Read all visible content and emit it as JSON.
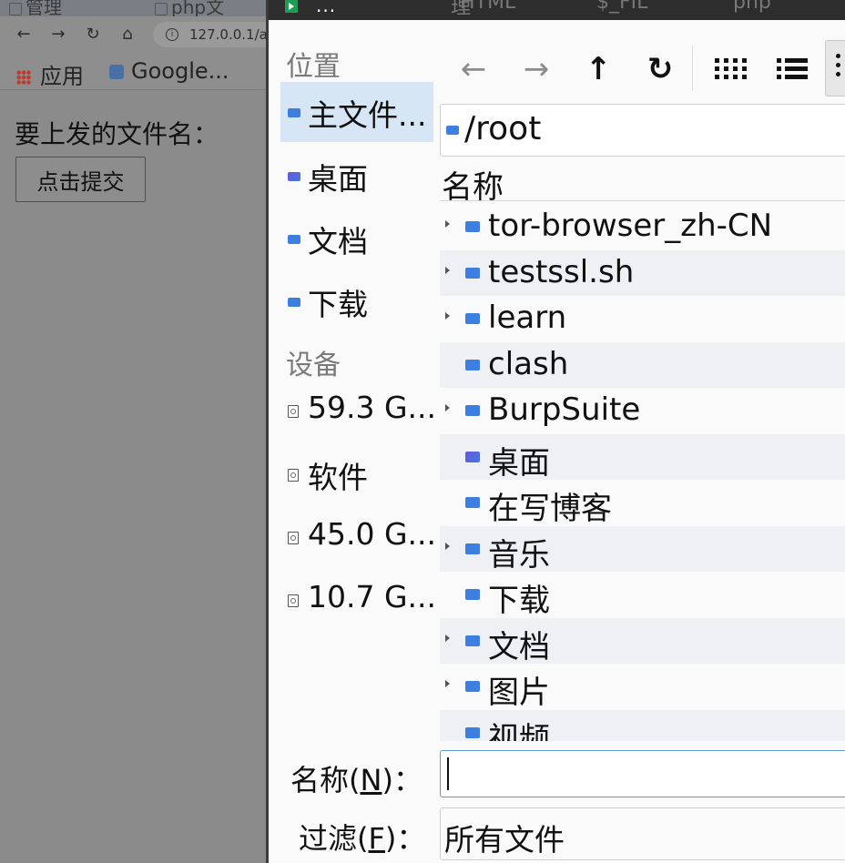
{
  "browser": {
    "tabs": [
      "管理",
      "php文"
    ],
    "address": "127.0.0.1/a",
    "bookmarks": {
      "apps_label": "应用",
      "google_label": "Google..."
    },
    "page": {
      "file_label": "要上发的文件名：",
      "submit_label": "点击提交"
    }
  },
  "dialog": {
    "title_dots": "...",
    "title_ghost": [
      "理",
      "HTML",
      "$_FIL",
      "php"
    ],
    "sidebar": {
      "places_heading": "位置",
      "places": [
        {
          "label": "主文件...",
          "icon": "home-folder-icon",
          "selected": true
        },
        {
          "label": "桌面",
          "icon": "desktop-folder-icon"
        },
        {
          "label": "文档",
          "icon": "documents-folder-icon"
        },
        {
          "label": "下载",
          "icon": "downloads-folder-icon"
        }
      ],
      "devices_heading": "设备",
      "devices": [
        {
          "label": "59.3 G...",
          "icon": "drive-icon"
        },
        {
          "label": "软件",
          "icon": "drive-icon"
        },
        {
          "label": "45.0 G...",
          "icon": "drive-icon"
        },
        {
          "label": "10.7 G...",
          "icon": "drive-icon"
        }
      ]
    },
    "toolbar": {
      "back": "←",
      "forward": "→",
      "up": "↑",
      "refresh": "↻"
    },
    "path": "/root",
    "column_header": "名称",
    "files": [
      {
        "name": "tor-browser_zh-CN",
        "expandable": true
      },
      {
        "name": "testssl.sh",
        "expandable": true
      },
      {
        "name": "learn",
        "expandable": true
      },
      {
        "name": "clash",
        "expandable": false
      },
      {
        "name": "BurpSuite",
        "expandable": true
      },
      {
        "name": "桌面",
        "expandable": false
      },
      {
        "name": "在写博客",
        "expandable": false
      },
      {
        "name": "音乐",
        "expandable": true
      },
      {
        "name": "下载",
        "expandable": false
      },
      {
        "name": "文档",
        "expandable": true
      },
      {
        "name": "图片",
        "expandable": true
      },
      {
        "name": "视频",
        "expandable": false
      }
    ],
    "name_label_prefix": "名称(",
    "name_label_key": "N",
    "name_label_suffix": ")：",
    "name_value": "",
    "filter_label_prefix": "过滤(",
    "filter_label_key": "F",
    "filter_label_suffix": ")：",
    "filter_value": "所有文件"
  },
  "colors": {
    "accent": "#3d7fe0",
    "selection": "#d6e6f5",
    "row_alt": "#eff0f3"
  }
}
